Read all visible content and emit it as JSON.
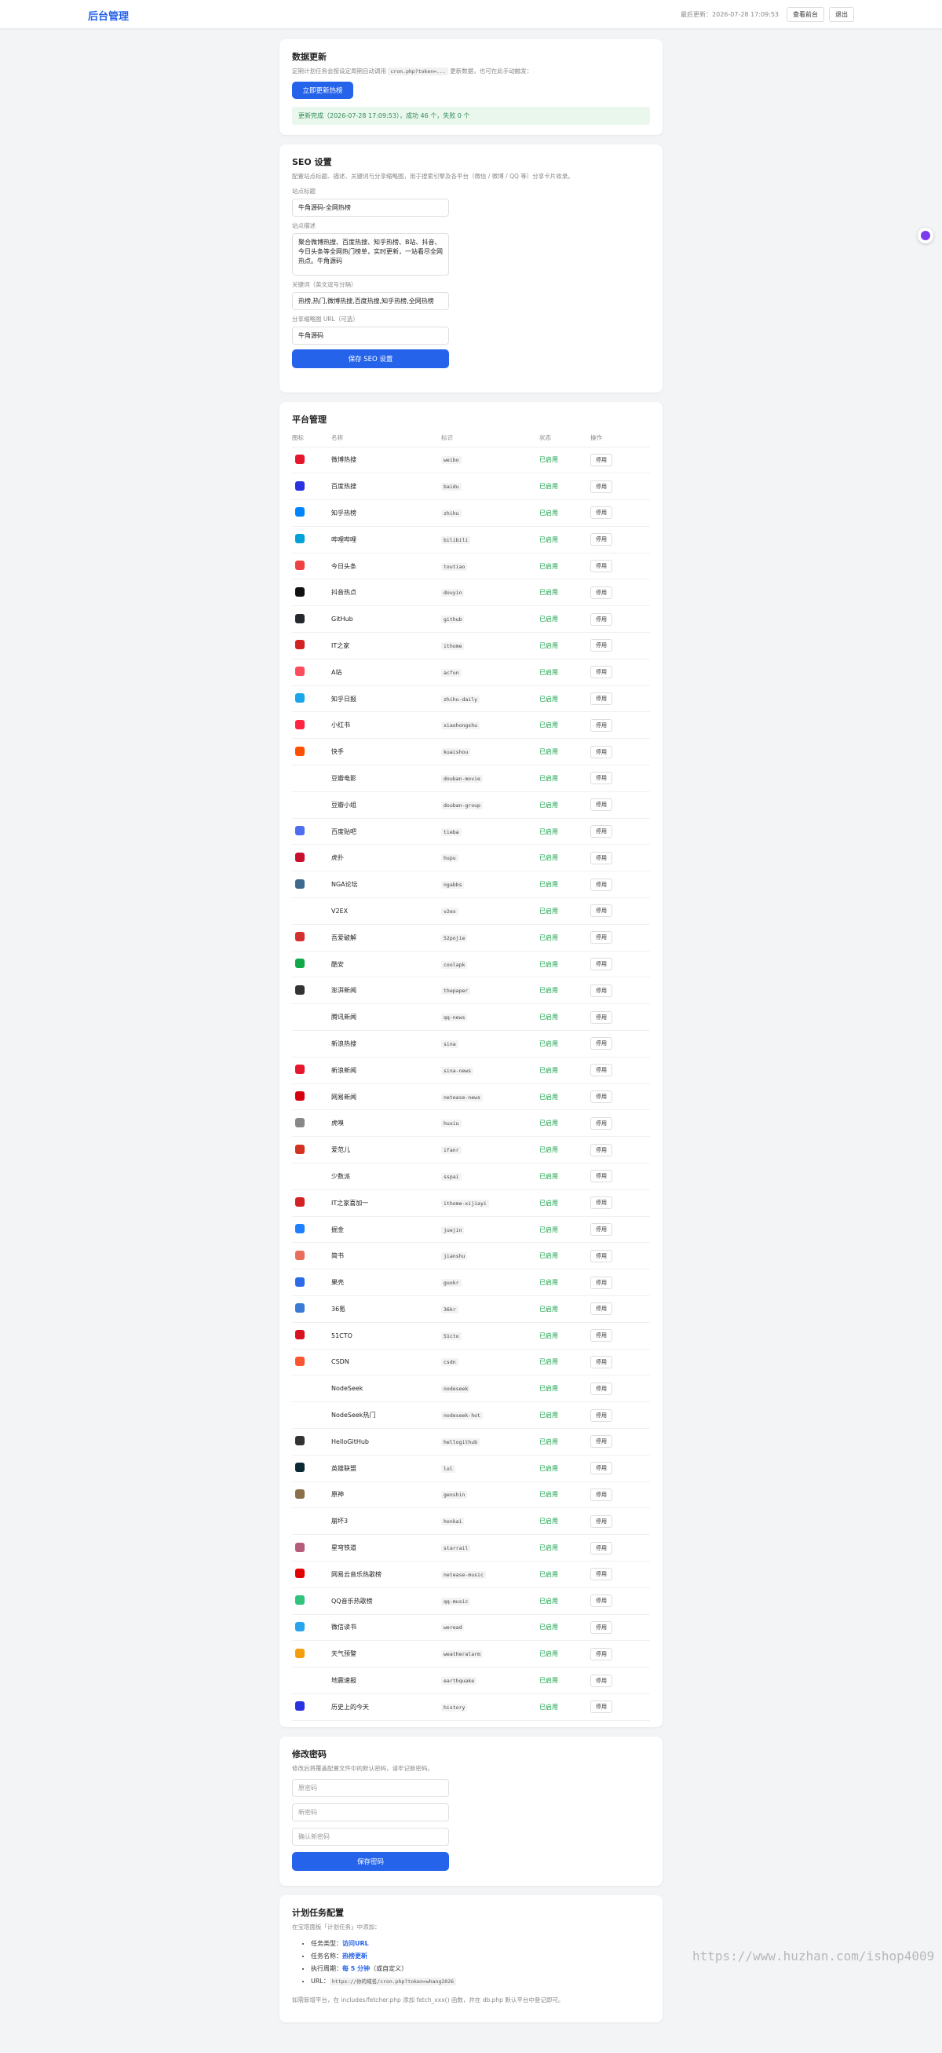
{
  "header": {
    "logo": "后台管理",
    "last_update": "最后更新：2026-07-28 17:09:53",
    "view_btn": "查看前台",
    "logout_btn": "退出"
  },
  "data_update": {
    "title": "数据更新",
    "desc_prefix": "定期计划任务会按设定周期自动调用",
    "desc_code": "cron.php?token=...",
    "desc_suffix": "更新数据，也可在此手动触发：",
    "button": "立即更新热榜",
    "message": "更新完成（2026-07-28 17:09:53），成功 46 个，失败 0 个"
  },
  "seo": {
    "title": "SEO 设置",
    "desc": "配置站点标题、描述、关键词与分享缩略图，用于搜索引擎及各平台（微信 / 微博 / QQ 等）分享卡片收录。",
    "site_title_label": "站点标题",
    "site_title": "牛角源码-全网热榜",
    "site_desc_label": "站点描述",
    "site_desc": "聚合微博热搜、百度热搜、知乎热榜、B站、抖音、今日头条等全网热门榜单，实时更新，一站看尽全网热点。牛角源码",
    "keywords_label": "关键词（英文逗号分隔）",
    "keywords": "热榜,热门,微博热搜,百度热搜,知乎热榜,全网热榜",
    "thumb_label": "分享缩略图 URL（可选）",
    "thumb": "牛角源码",
    "save": "保存 SEO 设置"
  },
  "platforms": {
    "title": "平台管理",
    "headers": [
      "图标",
      "名称",
      "标识",
      "状态",
      "操作"
    ],
    "status_label": "已启用",
    "action_label": "停用",
    "rows": [
      {
        "name": "微博热搜",
        "slug": "weibo",
        "color": "#e6162d"
      },
      {
        "name": "百度热搜",
        "slug": "baidu",
        "color": "#2932e1"
      },
      {
        "name": "知乎热榜",
        "slug": "zhihu",
        "color": "#0084ff"
      },
      {
        "name": "哔哩哔哩",
        "slug": "bilibili",
        "color": "#00a1d6"
      },
      {
        "name": "今日头条",
        "slug": "toutiao",
        "color": "#f04142"
      },
      {
        "name": "抖音热点",
        "slug": "douyin",
        "color": "#111111"
      },
      {
        "name": "GitHub",
        "slug": "github",
        "color": "#24292f"
      },
      {
        "name": "IT之家",
        "slug": "ithome",
        "color": "#d22222"
      },
      {
        "name": "A站",
        "slug": "acfun",
        "color": "#fd4c5c"
      },
      {
        "name": "知乎日报",
        "slug": "zhihu-daily",
        "color": "#1aa6e8"
      },
      {
        "name": "小红书",
        "slug": "xiaohongshu",
        "color": "#ff2442"
      },
      {
        "name": "快手",
        "slug": "kuaishou",
        "color": "#ff5000"
      },
      {
        "name": "豆瓣电影",
        "slug": "douban-movie",
        "color": ""
      },
      {
        "name": "豆瓣小组",
        "slug": "douban-group",
        "color": ""
      },
      {
        "name": "百度贴吧",
        "slug": "tieba",
        "color": "#4e6ef2"
      },
      {
        "name": "虎扑",
        "slug": "hupu",
        "color": "#c8102e"
      },
      {
        "name": "NGA论坛",
        "slug": "ngabbs",
        "color": "#3d6b8f"
      },
      {
        "name": "V2EX",
        "slug": "v2ex",
        "color": ""
      },
      {
        "name": "吾爱破解",
        "slug": "52pojie",
        "color": "#d32f2f"
      },
      {
        "name": "酷安",
        "slug": "coolapk",
        "color": "#11a84a"
      },
      {
        "name": "澎湃新闻",
        "slug": "thepaper",
        "color": "#333333"
      },
      {
        "name": "腾讯新闻",
        "slug": "qq-news",
        "color": ""
      },
      {
        "name": "新浪热搜",
        "slug": "sina",
        "color": ""
      },
      {
        "name": "新浪新闻",
        "slug": "sina-news",
        "color": "#e6162d"
      },
      {
        "name": "网易新闻",
        "slug": "netease-news",
        "color": "#d7000f"
      },
      {
        "name": "虎嗅",
        "slug": "huxiu",
        "color": "#888888"
      },
      {
        "name": "爱范儿",
        "slug": "ifanr",
        "color": "#d53120"
      },
      {
        "name": "少数派",
        "slug": "sspai",
        "color": ""
      },
      {
        "name": "IT之家喜加一",
        "slug": "ithome-xijiayi",
        "color": "#d22222"
      },
      {
        "name": "掘金",
        "slug": "juejin",
        "color": "#1e80ff"
      },
      {
        "name": "简书",
        "slug": "jianshu",
        "color": "#ea6f5a"
      },
      {
        "name": "果壳",
        "slug": "guokr",
        "color": "#2d6ae8"
      },
      {
        "name": "36氪",
        "slug": "36kr",
        "color": "#3a7bd5"
      },
      {
        "name": "51CTO",
        "slug": "51cto",
        "color": "#d8121f"
      },
      {
        "name": "CSDN",
        "slug": "csdn",
        "color": "#fc5531"
      },
      {
        "name": "NodeSeek",
        "slug": "nodeseek",
        "color": ""
      },
      {
        "name": "NodeSeek热门",
        "slug": "nodeseek-hot",
        "color": ""
      },
      {
        "name": "HelloGitHub",
        "slug": "hellogithub",
        "color": "#333333"
      },
      {
        "name": "英雄联盟",
        "slug": "lol",
        "color": "#0a2a33"
      },
      {
        "name": "原神",
        "slug": "genshin",
        "color": "#8b6f47"
      },
      {
        "name": "崩坏3",
        "slug": "honkai",
        "color": ""
      },
      {
        "name": "星穹铁道",
        "slug": "starrail",
        "color": "#b65c7a"
      },
      {
        "name": "网易云音乐热歌榜",
        "slug": "netease-music",
        "color": "#e20000"
      },
      {
        "name": "QQ音乐热歌榜",
        "slug": "qq-music",
        "color": "#31c27c"
      },
      {
        "name": "微信读书",
        "slug": "weread",
        "color": "#2aa3ef"
      },
      {
        "name": "天气预警",
        "slug": "weatheralarm",
        "color": "#f59e0b"
      },
      {
        "name": "地震速报",
        "slug": "earthquake",
        "color": ""
      },
      {
        "name": "历史上的今天",
        "slug": "history",
        "color": "#2932e1"
      }
    ]
  },
  "password": {
    "title": "修改密码",
    "desc": "修改后将覆盖配置文件中的默认密码，请牢记新密码。",
    "old_ph": "原密码",
    "new_ph": "新密码",
    "confirm_ph": "确认新密码",
    "save": "保存密码"
  },
  "cron": {
    "title": "计划任务配置",
    "desc": "在宝塔面板「计划任务」中添加：",
    "items": [
      {
        "label": "任务类型：",
        "value": "访问URL"
      },
      {
        "label": "任务名称：",
        "value": "热榜更新"
      },
      {
        "label": "执行周期：",
        "value": "每 5 分钟",
        "suffix": "（或自定义）"
      },
      {
        "label": "URL：",
        "value": "https://你的域名/cron.php?token=whang2026"
      }
    ],
    "note": "如需新增平台，在 includes/fetcher.php 添加 fetch_xxx() 函数，并在 db.php 默认平台中登记即可。"
  },
  "watermark": "https://www.huzhan.com/ishop4009"
}
